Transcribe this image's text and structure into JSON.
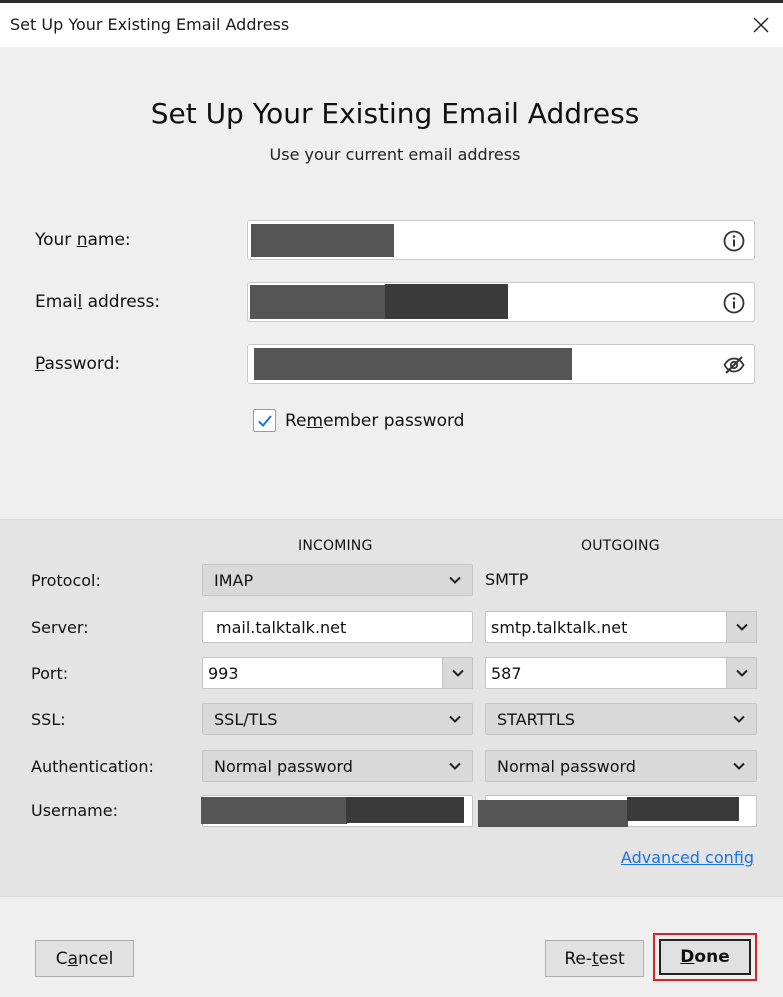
{
  "window": {
    "title": "Set Up Your Existing Email Address",
    "close_icon": "close-icon"
  },
  "header": {
    "heading": "Set Up Your Existing Email Address",
    "subheading": "Use your current email address"
  },
  "form": {
    "name": {
      "label_pre": "Your ",
      "label_accel": "n",
      "label_post": "ame:",
      "value": "",
      "redacted": true,
      "icon": "info-icon"
    },
    "email": {
      "label_pre": "Emai",
      "label_accel": "l",
      "label_post": " address:",
      "value": "",
      "redacted": true,
      "icon": "info-icon"
    },
    "password": {
      "label_pre": "",
      "label_accel": "P",
      "label_post": "assword:",
      "value": "",
      "redacted": true,
      "icon": "eye-slash-icon"
    },
    "remember": {
      "label_pre": "Re",
      "label_accel": "m",
      "label_post": "ember password",
      "checked": true
    }
  },
  "config": {
    "incoming_header": "INCOMING",
    "outgoing_header": "OUTGOING",
    "labels": {
      "protocol": "Protocol:",
      "server": "Server:",
      "port": "Port:",
      "ssl": "SSL:",
      "authentication": "Authentication:",
      "username": "Username:"
    },
    "incoming": {
      "protocol": "IMAP",
      "server": "mail.talktalk.net",
      "port": "993",
      "ssl": "SSL/TLS",
      "authentication": "Normal password",
      "username": ""
    },
    "outgoing": {
      "protocol": "SMTP",
      "server": "smtp.talktalk.net",
      "port": "587",
      "ssl": "STARTTLS",
      "authentication": "Normal password",
      "username": ""
    },
    "advanced_link": "Advanced config"
  },
  "footer": {
    "cancel_pre": "C",
    "cancel_accel": "a",
    "cancel_post": "ncel",
    "retest_pre": "Re-",
    "retest_accel": "t",
    "retest_post": "est",
    "done_accel": "D",
    "done_post": "one"
  },
  "colors": {
    "accent_link": "#1a73e8",
    "checkbox_check": "#1a73e8",
    "focus_highlight": "#d9232b",
    "redaction": "#555555"
  }
}
